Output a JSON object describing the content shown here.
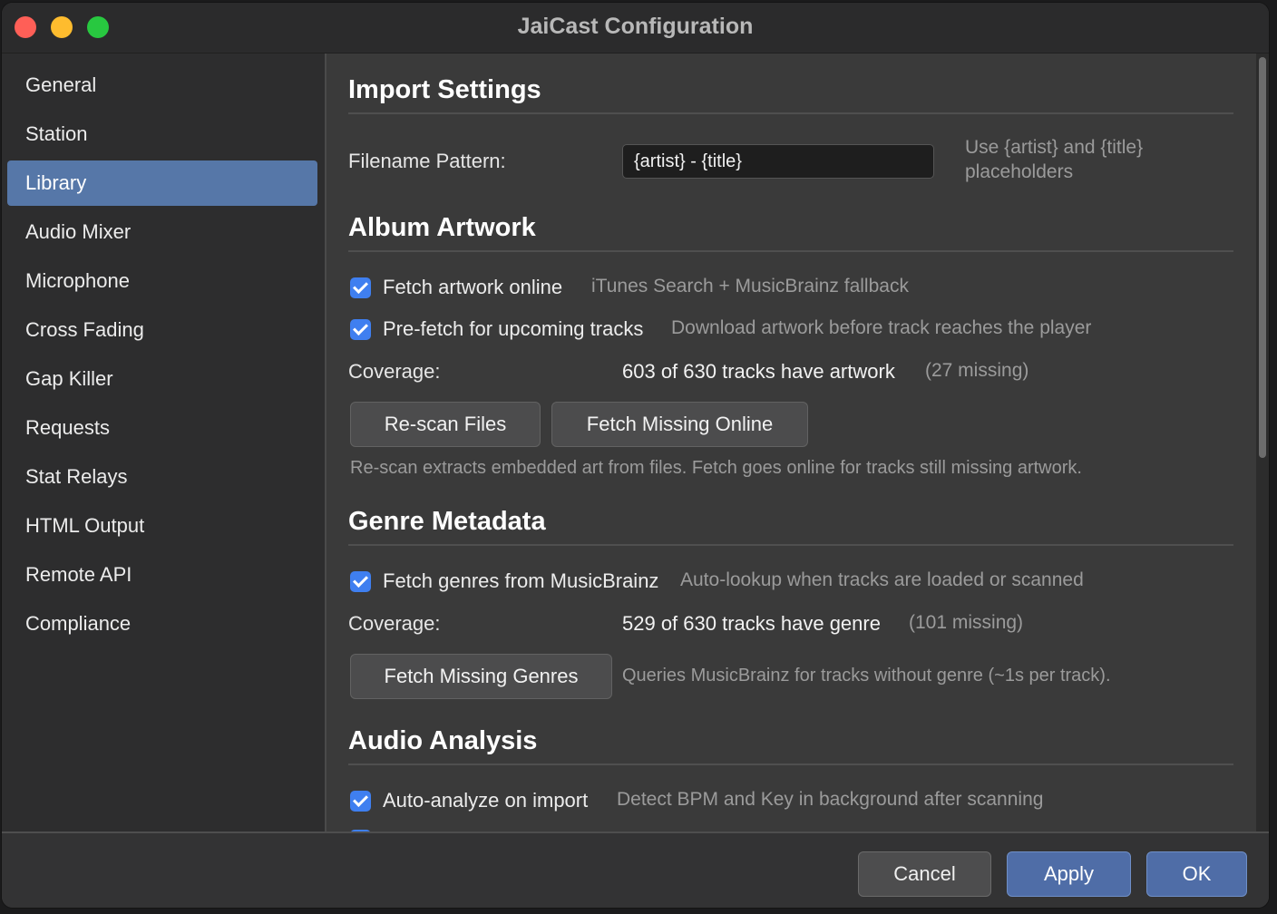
{
  "window": {
    "title": "JaiCast Configuration"
  },
  "sidebar": {
    "items": [
      {
        "label": "General"
      },
      {
        "label": "Station"
      },
      {
        "label": "Library",
        "selected": true
      },
      {
        "label": "Audio Mixer"
      },
      {
        "label": "Microphone"
      },
      {
        "label": "Cross Fading"
      },
      {
        "label": "Gap Killer"
      },
      {
        "label": "Requests"
      },
      {
        "label": "Stat Relays"
      },
      {
        "label": "HTML Output"
      },
      {
        "label": "Remote API"
      },
      {
        "label": "Compliance"
      }
    ]
  },
  "import_settings": {
    "title": "Import Settings",
    "filename_label": "Filename Pattern:",
    "filename_value": "{artist} - {title}",
    "filename_hint_line1": "Use {artist} and {title}",
    "filename_hint_line2": "placeholders"
  },
  "album_artwork": {
    "title": "Album Artwork",
    "fetch_online": {
      "label": "Fetch artwork online",
      "checked": true,
      "hint": "iTunes Search + MusicBrainz fallback"
    },
    "prefetch": {
      "label": "Pre-fetch for upcoming tracks",
      "checked": true,
      "hint": "Download artwork before track reaches the player"
    },
    "coverage_label": "Coverage:",
    "coverage_value": "603 of 630 tracks have artwork",
    "coverage_missing": "(27 missing)",
    "rescan_button": "Re-scan Files",
    "fetch_missing_button": "Fetch Missing Online",
    "note": "Re-scan extracts embedded art from files. Fetch goes online for tracks still missing artwork."
  },
  "genre_metadata": {
    "title": "Genre Metadata",
    "fetch_genres": {
      "label": "Fetch genres from MusicBrainz",
      "checked": true,
      "hint": "Auto-lookup when tracks are loaded or scanned"
    },
    "coverage_label": "Coverage:",
    "coverage_value": "529 of 630 tracks have genre",
    "coverage_missing": "(101 missing)",
    "fetch_missing_button": "Fetch Missing Genres",
    "note": "Queries MusicBrainz for tracks without genre (~1s per track)."
  },
  "audio_analysis": {
    "title": "Audio Analysis",
    "auto_analyze": {
      "label": "Auto-analyze on import",
      "checked": true,
      "hint": "Detect BPM and Key in background after scanning"
    }
  },
  "footer": {
    "cancel": "Cancel",
    "apply": "Apply",
    "ok": "OK"
  },
  "colors": {
    "accent": "#5677a8",
    "checkbox": "#3f7ff0",
    "background": "#3a3a3a",
    "sidebar": "#2d2d2e"
  }
}
